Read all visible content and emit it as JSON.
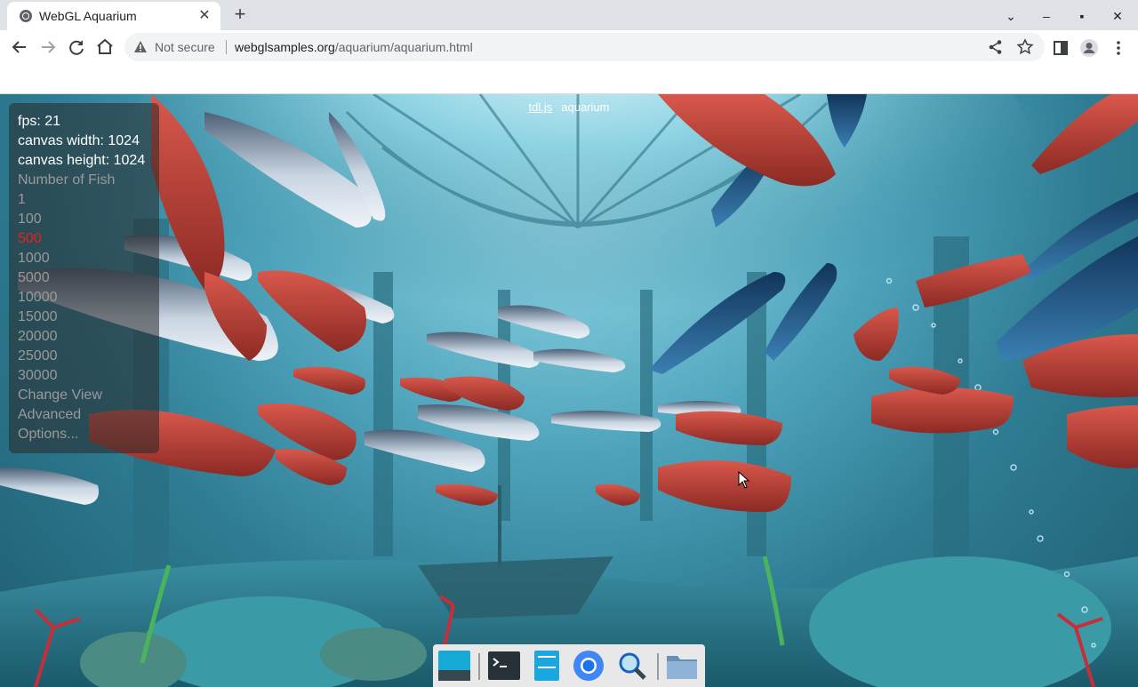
{
  "browser": {
    "tab": {
      "title": "WebGL Aquarium",
      "close": "✕"
    },
    "new_tab": "+",
    "window_controls": {
      "menu": "⌄",
      "minimize": "–",
      "maximize": "▪",
      "close": "✕"
    },
    "address": {
      "security_label": "Not secure",
      "url_host": "webglsamples.org",
      "url_path": "/aquarium/aquarium.html"
    },
    "icons": [
      "back-icon",
      "forward-icon",
      "reload-icon",
      "home-icon",
      "warning-icon",
      "share-icon",
      "star-icon",
      "side-panel-icon",
      "profile-icon",
      "menu-icon"
    ]
  },
  "page": {
    "header_link": "tdl.js",
    "header_text": "aquarium",
    "stats": {
      "fps": "fps: 21",
      "canvas_width": "canvas width: 1024",
      "canvas_height": "canvas height: 1024"
    },
    "fish_menu": {
      "heading": "Number of Fish",
      "options": [
        "1",
        "100",
        "500",
        "1000",
        "5000",
        "10000",
        "15000",
        "20000",
        "25000",
        "30000"
      ],
      "selected": "500"
    },
    "extra_options": [
      "Change View",
      "Advanced",
      "Options..."
    ],
    "colors": {
      "selected": "#e2241b",
      "unselected": "#9a9a9a"
    }
  },
  "taskbar": {
    "items": [
      "desktop-icon",
      "terminal-icon",
      "files-icon",
      "chromium-icon",
      "search-icon",
      "folder-icon"
    ]
  }
}
